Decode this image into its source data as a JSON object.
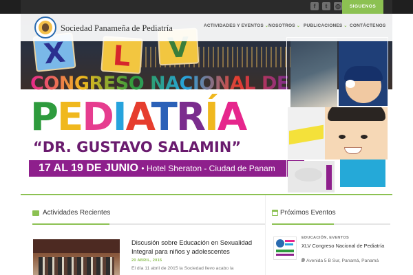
{
  "topbar": {
    "social": [
      {
        "icon": "facebook-icon",
        "glyph": "f"
      },
      {
        "icon": "twitter-icon",
        "glyph": "t"
      },
      {
        "icon": "instagram-icon",
        "glyph": "◎"
      }
    ],
    "follow_label": "SIGUENOS"
  },
  "header": {
    "site_name": "Sociedad Panameña de Pediatría",
    "nav": [
      {
        "label": "ACTIVIDADES Y EVENTOS",
        "has_submenu": true
      },
      {
        "label": "NOSOTROS",
        "has_submenu": true
      },
      {
        "label": "PUBLICACIONES",
        "has_submenu": true
      },
      {
        "label": "CONTÁCTENOS",
        "has_submenu": false
      }
    ]
  },
  "hero": {
    "blocks": [
      "X",
      "L",
      "V"
    ],
    "line1": "CONGRESO NACIONAL DE",
    "line2_letters": [
      {
        "ch": "P",
        "color": "#2e9b3d"
      },
      {
        "ch": "E",
        "color": "#f0b81e"
      },
      {
        "ch": "D",
        "color": "#e63d8f"
      },
      {
        "ch": "I",
        "color": "#27a3dd"
      },
      {
        "ch": "A",
        "color": "#e63d2e"
      },
      {
        "ch": "T",
        "color": "#2b61b8"
      },
      {
        "ch": "R",
        "color": "#7b2d8e"
      },
      {
        "ch": "Í",
        "color": "#f0b81e"
      },
      {
        "ch": "A",
        "color": "#e6268c"
      }
    ],
    "line3": "“DR. GUSTAVO SALAMIN”",
    "date_band": "17 AL 19 DE JUNIO",
    "venue": "• Hotel Sheraton - Ciudad de Panam"
  },
  "colors": {
    "accent": "#8cc152",
    "date_band": "#8e1f8c",
    "topbar": "#2b2b2b"
  },
  "recent": {
    "title": "Actividades Recientes",
    "item": {
      "title": "Discusión sobre Educación en Sexualidad Integral para niños y adolescentes",
      "date": "20 ABRIL, 2015",
      "excerpt": "El día 11 abril de 2015 la Sociedad llevo acabo la"
    }
  },
  "events": {
    "title": "Próximos Eventos",
    "item": {
      "category": "EDUCACIÓN, EVENTOS",
      "title": "XLV Congreso Nacional de Pediatría",
      "location": "Avenida 5 B Sur, Panamá, Panamá"
    }
  }
}
